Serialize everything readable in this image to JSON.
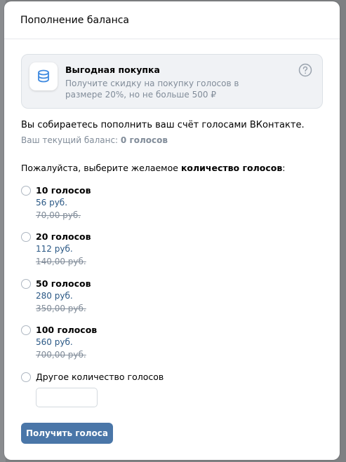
{
  "modal": {
    "title": "Пополнение баланса"
  },
  "promo": {
    "icon": "coins-icon",
    "title": "Выгодная покупка",
    "description": "Получите скидку на покупку голосов в размере 20%, но не больше 500 ₽",
    "help_icon": "question-circle-icon"
  },
  "intro": "Вы собираетесь пополнить ваш счёт голосами ВКонтакте.",
  "balance": {
    "label": "Ваш текущий баланс:",
    "value": "0 голосов"
  },
  "choose": {
    "text": "Пожалуйста, выберите желаемое",
    "bold": "количество голосов",
    "suffix": ":"
  },
  "options": [
    {
      "title": "10 голосов",
      "price": "56 руб.",
      "old_price": "70,00 руб."
    },
    {
      "title": "20 голосов",
      "price": "112 руб.",
      "old_price": "140,00 руб."
    },
    {
      "title": "50 голосов",
      "price": "280 руб.",
      "old_price": "350,00 руб."
    },
    {
      "title": "100 голосов",
      "price": "560 руб.",
      "old_price": "700,00 руб."
    }
  ],
  "custom_option": {
    "label": "Другое количество голосов",
    "value": ""
  },
  "submit_label": "Получить голоса",
  "colors": {
    "accent": "#4a76a8",
    "link": "#2a5885",
    "muted": "#818c99",
    "icon_blue": "#3f8ae0"
  }
}
